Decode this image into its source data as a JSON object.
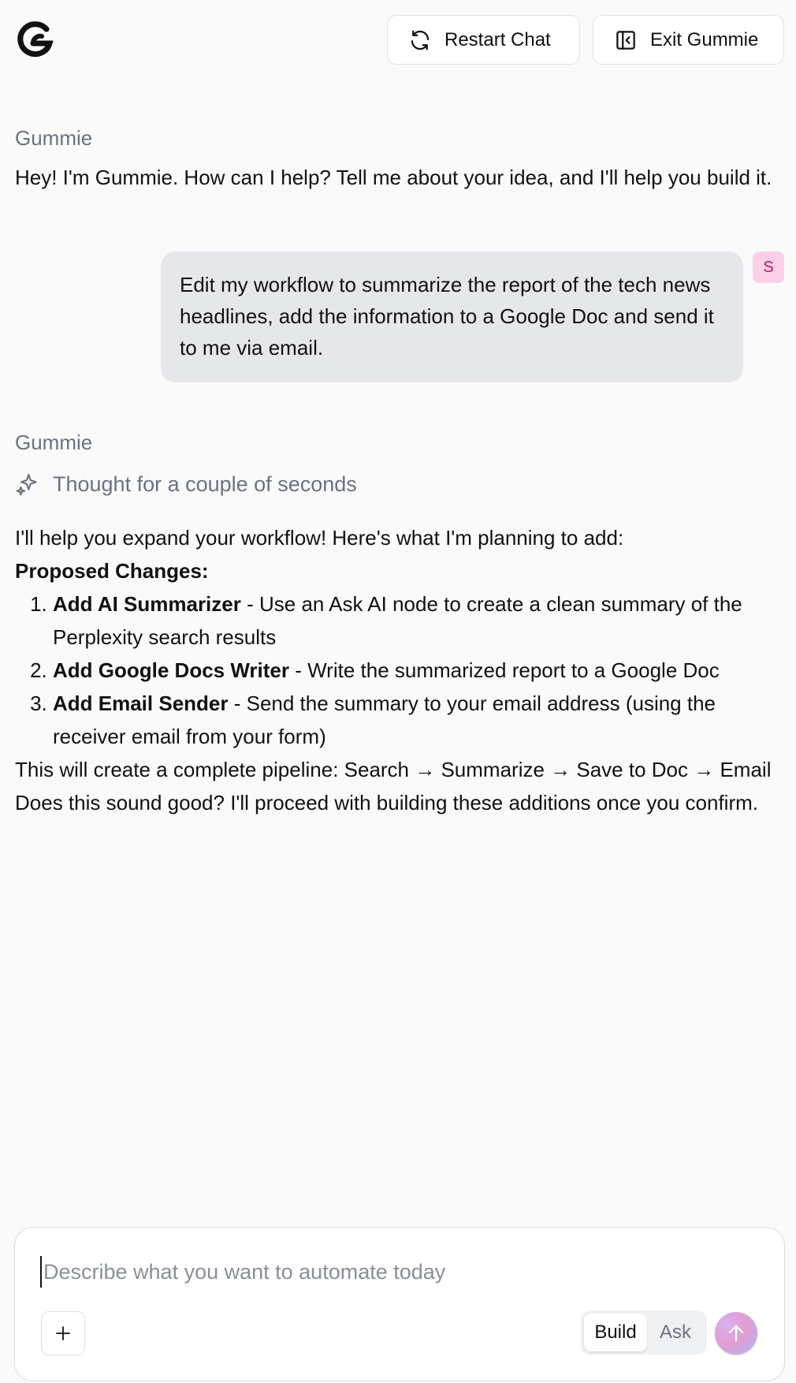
{
  "header": {
    "logo_icon": "gummie-logo-icon",
    "restart_label": "Restart Chat",
    "exit_label": "Exit Gummie"
  },
  "messages": [
    {
      "sender": "Gummie",
      "text": "Hey! I'm Gummie. How can I help? Tell me about your idea, and I'll help you build it."
    },
    {
      "sender_avatar": "S",
      "text": "Edit my workflow to summarize the report of the tech news headlines, add the information to a Google Doc and send it to me via email."
    },
    {
      "sender": "Gummie",
      "thought": "Thought for a couple of seconds",
      "intro": "I'll help you expand your workflow! Here's what I'm planning to add:",
      "heading": "Proposed Changes:",
      "items": [
        {
          "title": "Add AI Summarizer",
          "desc": " - Use an Ask AI node to create a clean summary of the Perplexity search results"
        },
        {
          "title": "Add Google Docs Writer",
          "desc": " - Write the summarized report to a Google Doc"
        },
        {
          "title": "Add Email Sender",
          "desc": " - Send the summary to your email address (using the receiver email from your form)"
        }
      ],
      "pipeline": "This will create a complete pipeline: Search → Summarize → Save to Doc → Email",
      "confirm": "Does this sound good? I'll proceed with building these additions once you confirm."
    }
  ],
  "composer": {
    "placeholder": "Describe what you want to automate today",
    "value": "",
    "mode_build": "Build",
    "mode_ask": "Ask",
    "selected_mode": "Build"
  }
}
